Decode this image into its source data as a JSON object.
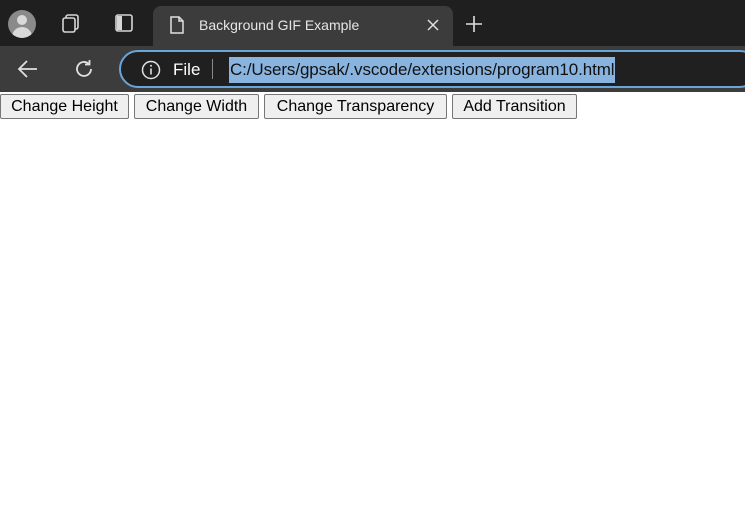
{
  "tab": {
    "title": "Background GIF Example"
  },
  "omnibox": {
    "scheme_label": "File",
    "url": "C:/Users/gpsak/.vscode/extensions/program10.html"
  },
  "icons": {
    "profile": "profile-avatar-icon",
    "workspaces": "workspaces-icon",
    "tab_actions": "tab-actions-icon",
    "page": "page-icon",
    "close": "close-icon",
    "new_tab": "plus-icon",
    "back": "back-arrow-icon",
    "reload": "reload-icon",
    "info": "info-icon"
  },
  "page": {
    "buttons": [
      {
        "label": "Change Height"
      },
      {
        "label": "Change Width"
      },
      {
        "label": "Change Transparency"
      },
      {
        "label": "Add Transition"
      }
    ]
  },
  "colors": {
    "tabstrip_bg": "#1f1f1f",
    "toolbar_bg": "#3c3c3c",
    "omnibox_border": "#6ba5d7",
    "url_selection": "#8ab4e0"
  }
}
